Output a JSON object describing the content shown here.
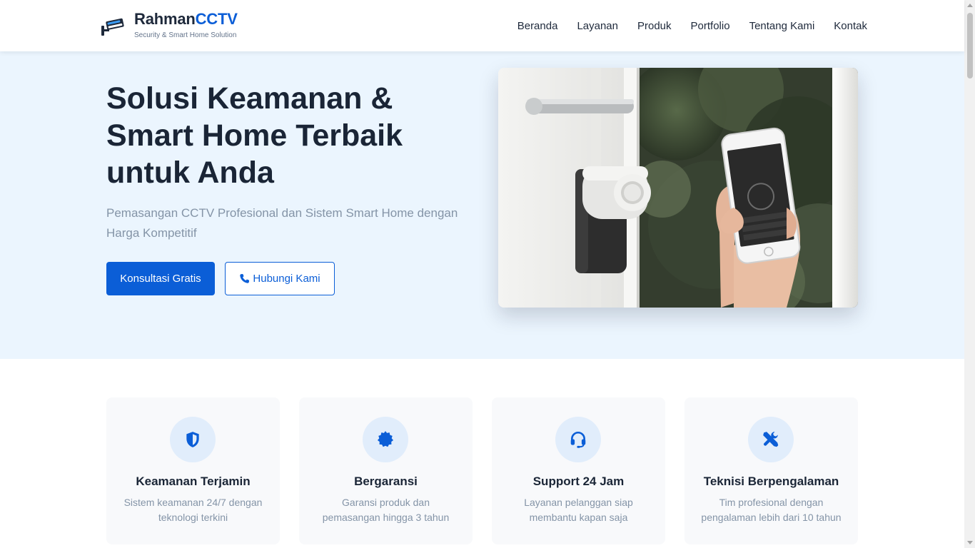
{
  "brand": {
    "name_main": "Rahman",
    "name_accent": "CCTV",
    "tagline": "Security & Smart Home Solution",
    "icon": "cctv-camera-icon"
  },
  "nav": {
    "items": [
      "Beranda",
      "Layanan",
      "Produk",
      "Portfolio",
      "Tentang Kami",
      "Kontak"
    ]
  },
  "hero": {
    "title": "Solusi Keamanan & Smart Home Terbaik untuk Anda",
    "subtitle": "Pemasangan CCTV Profesional dan Sistem Smart Home dengan Harga Kompetitif",
    "primary_button": "Konsultasi Gratis",
    "secondary_button": "Hubungi Kami",
    "secondary_button_icon": "phone-icon",
    "image": "smart-lock-phone-photo"
  },
  "features": [
    {
      "icon": "shield-icon",
      "title": "Keamanan Terjamin",
      "desc": "Sistem keamanan 24/7 dengan teknologi terkini"
    },
    {
      "icon": "badge-certificate-icon",
      "title": "Bergaransi",
      "desc": "Garansi produk dan pemasangan hingga 3 tahun"
    },
    {
      "icon": "headset-icon",
      "title": "Support 24 Jam",
      "desc": "Layanan pelanggan siap membantu kapan saja"
    },
    {
      "icon": "tools-icon",
      "title": "Teknisi Berpengalaman",
      "desc": "Tim profesional dengan pengalaman lebih dari 10 tahun"
    }
  ],
  "colors": {
    "accent": "#0b5ed7",
    "hero_bg": "#ebf5fe",
    "heading": "#1a2536",
    "muted": "#8494a7"
  }
}
